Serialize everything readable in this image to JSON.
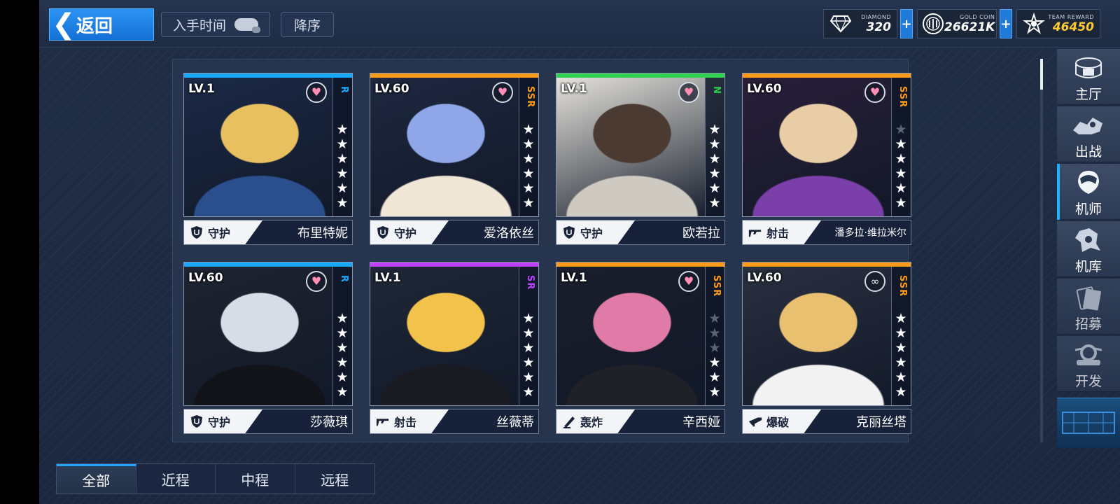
{
  "header": {
    "back_label": "返回",
    "sort_by_label": "入手时间",
    "order_label": "降序"
  },
  "resources": {
    "diamond": {
      "caption": "DIAMOND",
      "value": "320"
    },
    "gold": {
      "caption": "GOLD COIN",
      "value": "26621K"
    },
    "team_reward": {
      "caption": "TEAM REWARD",
      "value": "46450"
    },
    "plus_label": "+"
  },
  "colors": {
    "rarity_R": "#18a8ff",
    "rarity_SR": "#c040ff",
    "rarity_SSR": "#ff9a1a",
    "rarity_N": "#30d050",
    "heart": "#ff8db4",
    "accent": "#22a4ff"
  },
  "cards": [
    {
      "level": "LV.1",
      "rarity": "R",
      "stars": 6,
      "role": "守护",
      "role_icon": "shield-icon",
      "name": "布里特妮",
      "badge": "heart"
    },
    {
      "level": "LV.60",
      "rarity": "SSR",
      "stars": 6,
      "role": "守护",
      "role_icon": "shield-icon",
      "name": "爱洛依丝",
      "badge": "heart"
    },
    {
      "level": "LV.1",
      "rarity": "N",
      "stars": 6,
      "role": "守护",
      "role_icon": "shield-icon",
      "name": "欧若拉",
      "badge": "heart"
    },
    {
      "level": "LV.60",
      "rarity": "SSR",
      "stars": 5,
      "role": "射击",
      "role_icon": "gun-icon",
      "name": "潘多拉·维拉米尔",
      "badge": "heart"
    },
    {
      "level": "LV.60",
      "rarity": "R",
      "stars": 6,
      "role": "守护",
      "role_icon": "shield-icon",
      "name": "莎薇琪",
      "badge": "heart"
    },
    {
      "level": "LV.1",
      "rarity": "SR",
      "stars": 6,
      "role": "射击",
      "role_icon": "gun-icon",
      "name": "丝薇蒂",
      "badge": "none"
    },
    {
      "level": "LV.1",
      "rarity": "SSR",
      "stars": 3,
      "role": "轰炸",
      "role_icon": "mortar-icon",
      "name": "辛西娅",
      "badge": "heart"
    },
    {
      "level": "LV.60",
      "rarity": "SSR",
      "stars": 6,
      "role": "爆破",
      "role_icon": "launcher-icon",
      "name": "克丽丝塔",
      "badge": "ring"
    }
  ],
  "right_nav": [
    {
      "label": "主厅",
      "icon": "hall-icon"
    },
    {
      "label": "出战",
      "icon": "battle-icon"
    },
    {
      "label": "机师",
      "icon": "pilot-icon",
      "active": true
    },
    {
      "label": "机库",
      "icon": "hangar-icon"
    },
    {
      "label": "招募",
      "icon": "recruit-icon"
    },
    {
      "label": "开发",
      "icon": "develop-icon"
    }
  ],
  "bottom_tabs": [
    {
      "label": "全部",
      "active": true
    },
    {
      "label": "近程"
    },
    {
      "label": "中程"
    },
    {
      "label": "远程"
    }
  ]
}
